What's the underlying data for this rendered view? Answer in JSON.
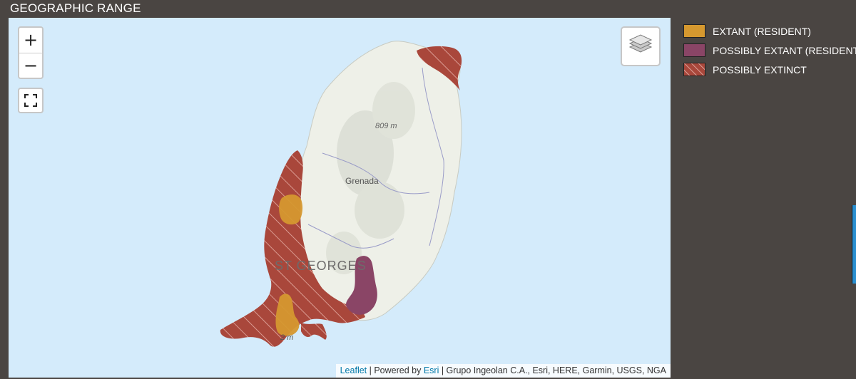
{
  "header": {
    "title": "GEOGRAPHIC RANGE"
  },
  "map": {
    "zoom_in_label": "+",
    "zoom_out_label": "−",
    "labels": {
      "island": "Grenada",
      "parish": "ST GEORGES",
      "peak": "809 m",
      "peak2": "2 m"
    },
    "attribution": {
      "leaflet": "Leaflet",
      "sep1": " | Powered by ",
      "esri": "Esri",
      "rest": " | Grupo Ingeolan C.A., Esri, HERE, Garmin, USGS, NGA"
    }
  },
  "legend": {
    "items": [
      {
        "label": "EXTANT (RESIDENT)",
        "color": "#d5982f"
      },
      {
        "label": "POSSIBLY EXTANT (RESIDENT)",
        "color": "#8a4566"
      },
      {
        "label": "POSSIBLY EXTINCT",
        "color": "#a9473b"
      }
    ]
  },
  "colors": {
    "water": "#d4ebfb",
    "land": "#eef0e8",
    "extinct": "#a9473b",
    "extant": "#d5982f",
    "possibly_extant": "#8a4566",
    "background": "#4a4542"
  }
}
